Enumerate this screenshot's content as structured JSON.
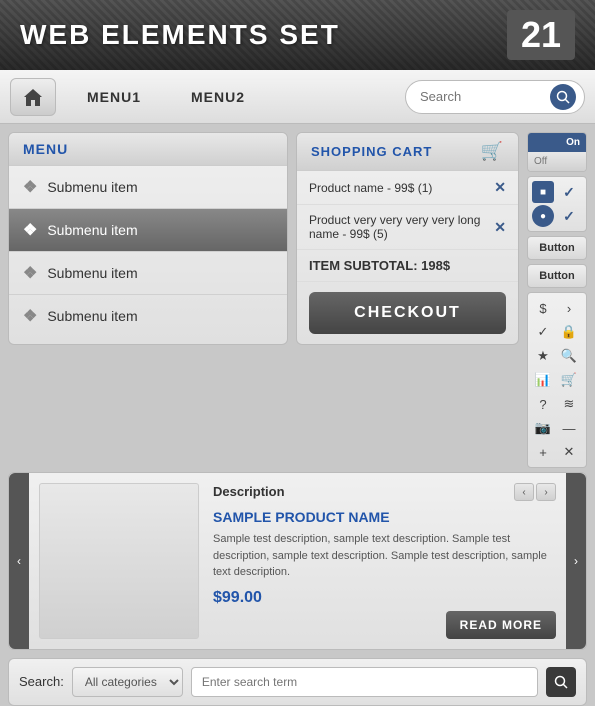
{
  "header": {
    "title": "WEB ELEMENTS SET",
    "number": "21"
  },
  "nav": {
    "menu1_label": "MENU1",
    "menu2_label": "MENU2",
    "search_placeholder": "Search",
    "home_tooltip": "Home"
  },
  "menu": {
    "header_label": "MENU",
    "items": [
      {
        "label": "Submenu item",
        "active": false
      },
      {
        "label": "Submenu item",
        "active": true
      },
      {
        "label": "Submenu item",
        "active": false
      },
      {
        "label": "Submenu item",
        "active": false
      }
    ]
  },
  "cart": {
    "header_label": "SHOPPING CART",
    "items": [
      {
        "name": "Product name - 99$ (1)"
      },
      {
        "name": "Product very very very very long name - 99$ (5)"
      }
    ],
    "subtotal_label": "ITEM SUBTOTAL: 198$",
    "checkout_label": "CHECKOUT"
  },
  "widgets": {
    "toggle_on": "On",
    "toggle_off": "Off",
    "button1_label": "Button",
    "button2_label": "Button",
    "icons": [
      "$",
      "›",
      "✓",
      "🔒",
      "★",
      "🔍",
      "📊",
      "🛒",
      "?",
      "≋",
      "📷",
      "—",
      "+",
      "✕"
    ]
  },
  "product": {
    "description_label": "Description",
    "name": "SAMPLE PRODUCT NAME",
    "description": "Sample test description, sample text description. Sample test description, sample text description. Sample test description, sample text description.",
    "price": "$99.00",
    "read_more_label": "READ MORE"
  },
  "search_bar": {
    "label": "Search:",
    "category_options": [
      "All categories"
    ],
    "search_placeholder": "Enter search term"
  }
}
